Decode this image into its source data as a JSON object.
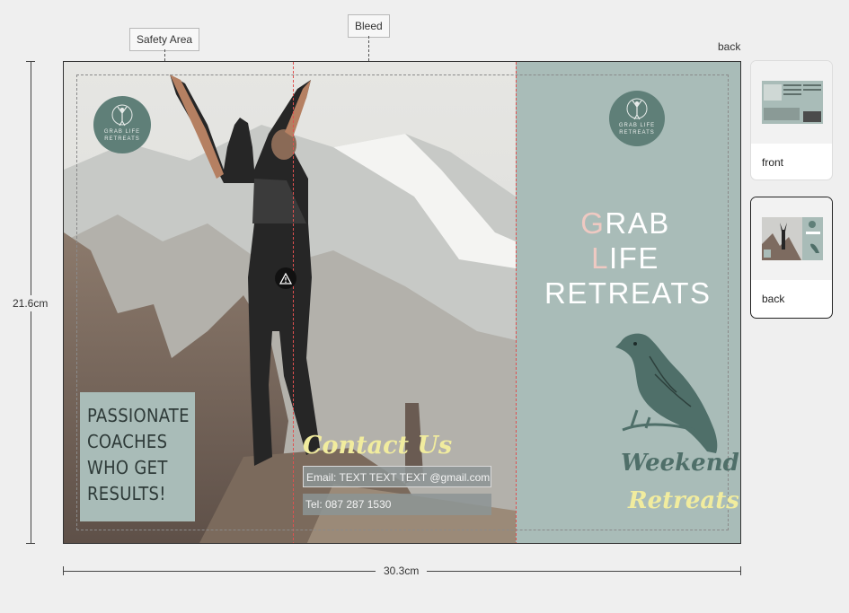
{
  "callouts": {
    "safety_area": "Safety Area",
    "bleed": "Bleed"
  },
  "side_label": "back",
  "dimensions": {
    "height": "21.6cm",
    "width": "30.3cm"
  },
  "sheet": {
    "logo_text_1": "GRAB LIFE",
    "logo_text_2": "RETREATS",
    "passionate_lines": [
      "PASSIONATE",
      "COACHES",
      "WHO GET",
      "RESULTS!"
    ],
    "contact_title": "Contact Us",
    "email": "Email: TEXT TEXT TEXT @gmail.com",
    "phone": "Tel: 087 287 1530",
    "brand_line_1_first": "G",
    "brand_line_1_a": "RAB ",
    "brand_line_1_second": "L",
    "brand_line_1_b": "IFE",
    "brand_line_2": "RETREATS",
    "weekend": "Weekend",
    "retreats": "Retreats"
  },
  "thumbnails": [
    {
      "label": "front",
      "selected": false
    },
    {
      "label": "back",
      "selected": true
    }
  ],
  "colors": {
    "teal_panel": "#a9bcb8",
    "logo": "#5f7f78",
    "fold_line": "#e05050",
    "script_yellow": "#f1ec9e"
  },
  "icons": {
    "warning": "warning-triangle-icon",
    "bird": "bird-illustration"
  }
}
